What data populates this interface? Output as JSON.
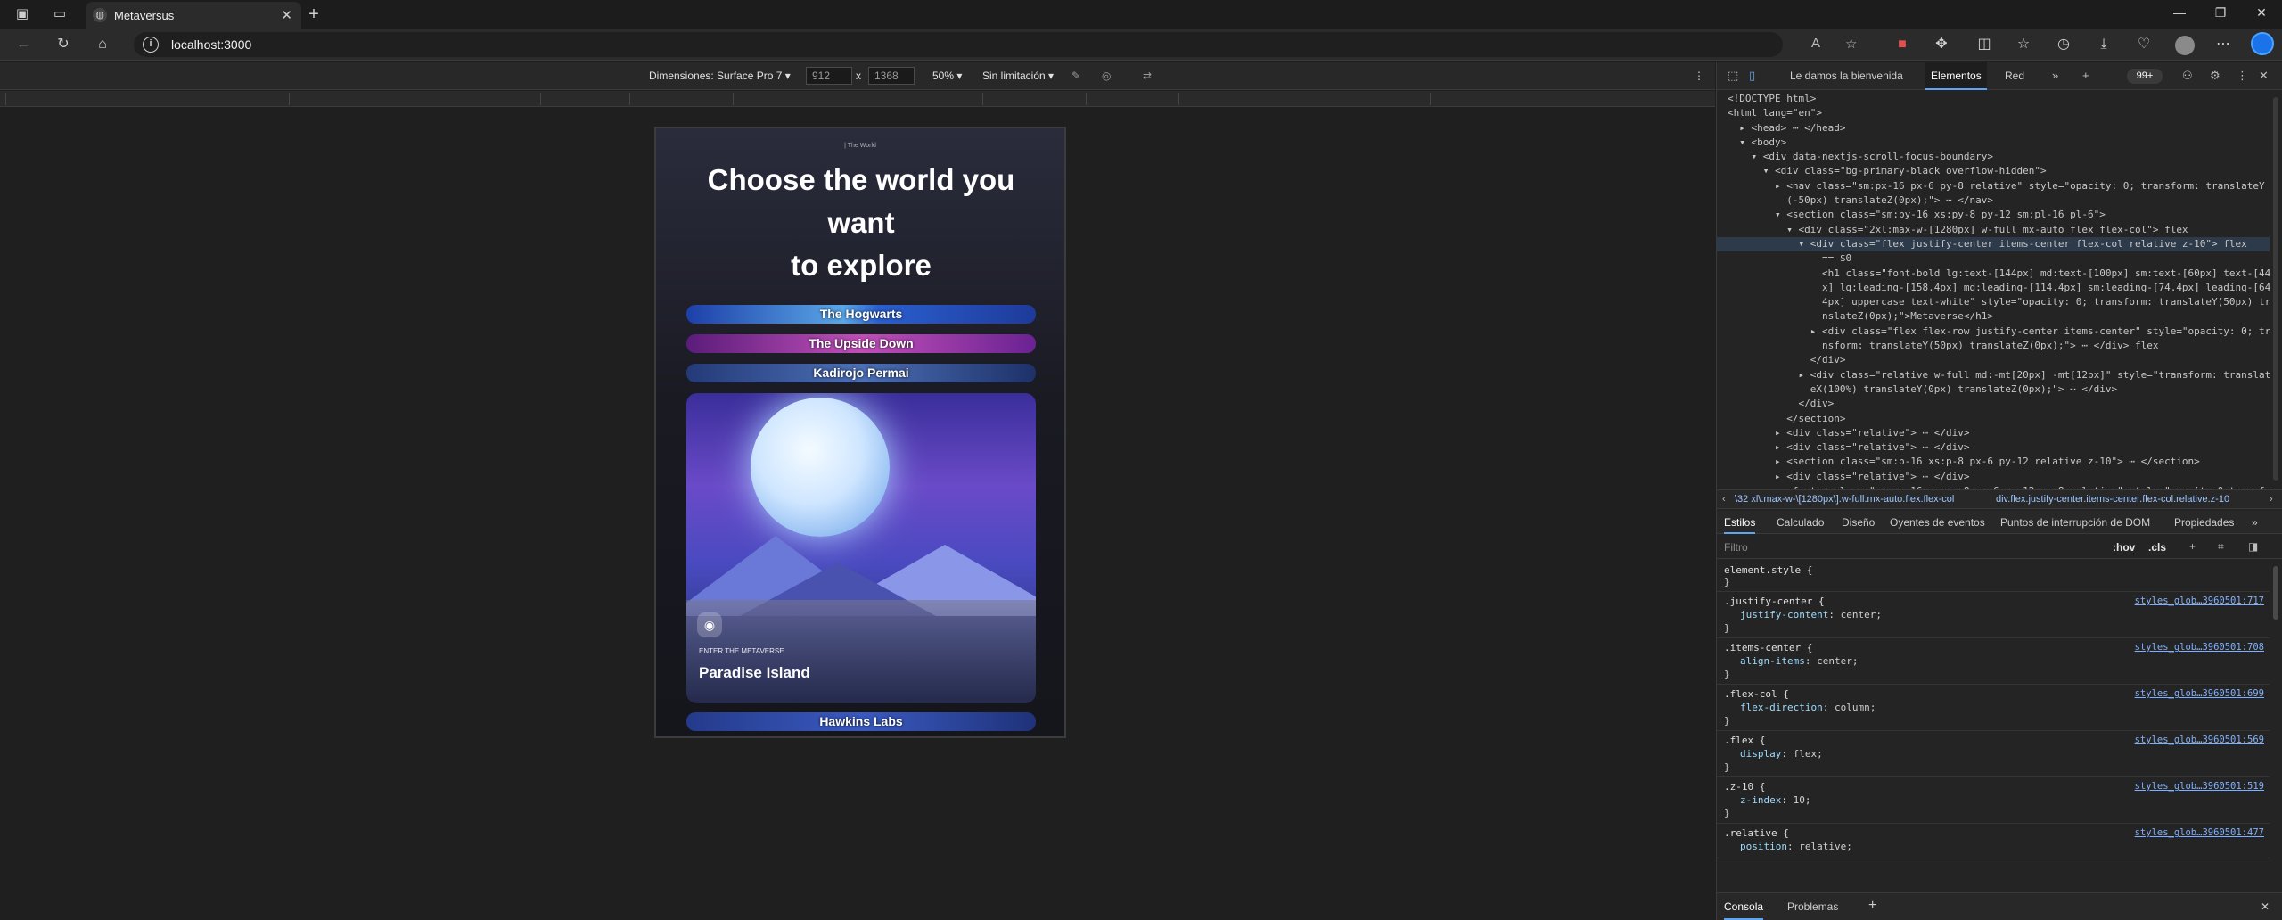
{
  "browser": {
    "tab_title": "Metaversus",
    "url": "localhost:3000"
  },
  "device_toolbar": {
    "dimensions_label": "Dimensiones: Surface Pro 7 ▾",
    "width": "912",
    "times": "x",
    "height": "1368",
    "zoom": "50% ▾",
    "throttle": "Sin limitación ▾"
  },
  "page": {
    "eyebrow": "| The World",
    "headline_line1": "Choose the world you",
    "headline_line2": "want",
    "headline_line3": "to explore",
    "worlds": [
      "The Hogwarts",
      "The Upside Down",
      "Kadirojo Permai",
      "Hawkins Labs"
    ],
    "featured": {
      "eyebrow": "ENTER THE METAVERSE",
      "title": "Paradise Island"
    }
  },
  "devtools": {
    "tabs": {
      "welcome": "Le damos la bienvenida",
      "elements": "Elementos",
      "network": "Red"
    },
    "badge": "99+",
    "dom_lines": [
      "<!DOCTYPE html>",
      "<html lang=\"en\">",
      "  ▸ <head> ⋯ </head>",
      "  ▾ <body>",
      "    ▾ <div data-nextjs-scroll-focus-boundary>",
      "      ▾ <div class=\"bg-primary-black overflow-hidden\">",
      "        ▸ <nav class=\"sm:px-16 px-6 py-8 relative\" style=\"opacity: 0; transform: translateY",
      "          (-50px) translateZ(0px);\"> ⋯ </nav>",
      "        ▾ <section class=\"sm:py-16 xs:py-8 py-12 sm:pl-16 pl-6\">",
      "          ▾ <div class=\"2xl:max-w-[1280px] w-full mx-auto flex flex-col\"> flex",
      "            ▾ <div class=\"flex justify-center items-center flex-col relative z-10\"> flex",
      "                == $0",
      "                <h1 class=\"font-bold lg:text-[144px] md:text-[100px] sm:text-[60px] text-[44p",
      "                x] lg:leading-[158.4px] md:leading-[114.4px] sm:leading-[74.4px] leading-[64.",
      "                4px] uppercase text-white\" style=\"opacity: 0; transform: translateY(50px) tra",
      "                nslateZ(0px);\">Metaverse</h1>",
      "              ▸ <div class=\"flex flex-row justify-center items-center\" style=\"opacity: 0; tra",
      "                nsform: translateY(50px) translateZ(0px);\"> ⋯ </div> flex",
      "              </div>",
      "            ▸ <div class=\"relative w-full md:-mt[20px] -mt[12px]\" style=\"transform: translat",
      "              eX(100%) translateY(0px) translateZ(0px);\"> ⋯ </div>",
      "            </div>",
      "          </section>",
      "        ▸ <div class=\"relative\"> ⋯ </div>",
      "        ▸ <div class=\"relative\"> ⋯ </div>",
      "        ▸ <section class=\"sm:p-16 xs:p-8 px-6 py-12 relative z-10\"> ⋯ </section>",
      "        ▸ <div class=\"relative\"> ⋯ </div>",
      "        ▸ <footer class=\"sm:px-16 xs:px-8 px-6 py-12 py-8 relative\" style=\"opacity:0;transfor"
    ],
    "breadcrumb_1": "\\32 xl\\:max-w-\\[1280px\\].w-full.mx-auto.flex.flex-col",
    "breadcrumb_2": "div.flex.justify-center.items-center.flex-col.relative.z-10",
    "style_tabs": {
      "styles": "Estilos",
      "computed": "Calculado",
      "layout": "Diseño",
      "listeners": "Oyentes de eventos",
      "dom_breakpoints": "Puntos de interrupción de DOM",
      "properties": "Propiedades"
    },
    "filter_placeholder": "Filtro",
    "hov": ":hov",
    "cls": ".cls",
    "rules": [
      {
        "selector": "element.style {",
        "source": "",
        "decl": "",
        "end": "}"
      },
      {
        "selector": ".justify-center {",
        "source": "styles_glob…3960501:717",
        "decl_prop": "justify-content",
        "decl_val": "center;",
        "end": "}"
      },
      {
        "selector": ".items-center {",
        "source": "styles_glob…3960501:708",
        "decl_prop": "align-items",
        "decl_val": "center;",
        "end": "}"
      },
      {
        "selector": ".flex-col {",
        "source": "styles_glob…3960501:699",
        "decl_prop": "flex-direction",
        "decl_val": "column;",
        "end": "}"
      },
      {
        "selector": ".flex {",
        "source": "styles_glob…3960501:569",
        "decl_prop": "display",
        "decl_val": "flex;",
        "end": "}"
      },
      {
        "selector": ".z-10 {",
        "source": "styles_glob…3960501:519",
        "decl_prop": "z-index",
        "decl_val": "10;",
        "end": "}"
      },
      {
        "selector": ".relative {",
        "source": "styles_glob…3960501:477",
        "decl_prop": "position",
        "decl_val": "relative;",
        "end": ""
      }
    ],
    "console": {
      "console": "Consola",
      "issues": "Problemas"
    }
  }
}
